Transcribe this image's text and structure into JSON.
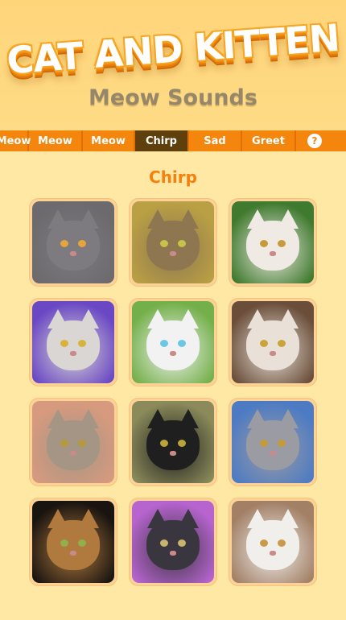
{
  "logo_text": "CAT AND KITTEN",
  "subtitle": "Meow Sounds",
  "tabs": [
    {
      "label": "Meow",
      "active": false
    },
    {
      "label": "Meow",
      "active": false
    },
    {
      "label": "Meow",
      "active": false
    },
    {
      "label": "Chirp",
      "active": true
    },
    {
      "label": "Sad",
      "active": false
    },
    {
      "label": "Greet",
      "active": false
    }
  ],
  "help_label": "?",
  "section_title": "Chirp",
  "cats": [
    {
      "bg": "#6d6a6e",
      "fur": "#7d7a80",
      "eyes": "#e5a53b"
    },
    {
      "bg": "#b9a044",
      "fur": "#8e7650",
      "eyes": "#c7c24a"
    },
    {
      "bg": "#3f7a2e",
      "fur": "#efeae4",
      "eyes": "#c79a3b"
    },
    {
      "bg": "#6a48c4",
      "fur": "#d9d6d3",
      "eyes": "#d6b43a"
    },
    {
      "bg": "#74b04a",
      "fur": "#f2f2f2",
      "eyes": "#6cc7e4"
    },
    {
      "bg": "#6a4e3a",
      "fur": "#e9e1d8",
      "eyes": "#caa43a"
    },
    {
      "bg": "#d79a7e",
      "fur": "#a59584",
      "eyes": "#b49a3a"
    },
    {
      "bg": "#8a8a5a",
      "fur": "#1f1f1f",
      "eyes": "#b9a43a"
    },
    {
      "bg": "#4d7bc3",
      "fur": "#9b9ba3",
      "eyes": "#c49a3a"
    },
    {
      "bg": "#1a1410",
      "fur": "#b07a3f",
      "eyes": "#8fb04a"
    },
    {
      "bg": "#b764cf",
      "fur": "#3a3640",
      "eyes": "#c8b46a"
    },
    {
      "bg": "#a28066",
      "fur": "#f1efec",
      "eyes": "#c99a4a"
    }
  ]
}
